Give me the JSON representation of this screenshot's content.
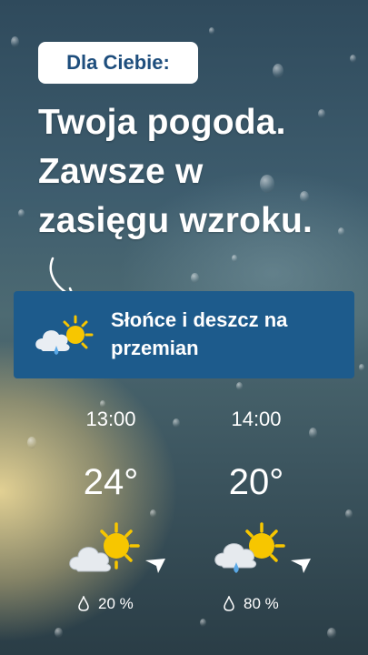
{
  "tag": {
    "label": "Dla Ciebie:"
  },
  "headline": {
    "lines": [
      "Twoja pogoda.",
      "Zawsze w",
      "zasięgu wzroku."
    ]
  },
  "banner": {
    "text": "Słońce i deszcz na przemian",
    "icon": "sun-cloud-rain-icon"
  },
  "forecast": [
    {
      "time": "13:00",
      "temp": "24°",
      "icon": "sun-cloud-icon",
      "wind_icon": "wind-direction-arrow-icon",
      "precip": "20 %"
    },
    {
      "time": "14:00",
      "temp": "20°",
      "icon": "sun-cloud-rain-icon",
      "wind_icon": "wind-direction-arrow-icon",
      "precip": "80 %"
    }
  ],
  "colors": {
    "banner": "#1d5b8c",
    "tag_text": "#1e4e7d",
    "sun": "#f7c600",
    "rain_drop": "#5aa8e6"
  }
}
